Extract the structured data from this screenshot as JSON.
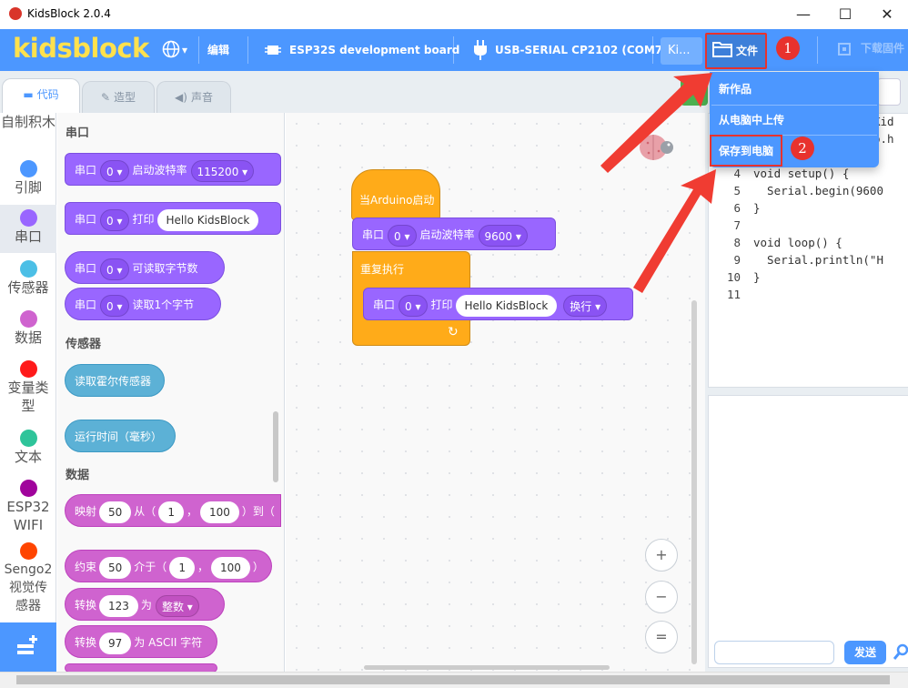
{
  "window": {
    "title": "KidsBlock 2.0.4",
    "minimize": "—",
    "maximize": "☐",
    "close": "✕"
  },
  "menubar": {
    "logo": "kidsblock",
    "language_caret": "▾",
    "edit": "编辑",
    "board": "ESP32S development board",
    "port": "USB-SERIAL CP2102 (COM7)",
    "project_name": "Ki...",
    "file": "文件",
    "download": "下载固件"
  },
  "markers": {
    "one": "1",
    "two": "2"
  },
  "tabs": {
    "code": "代码",
    "costume": "造型",
    "sound": "声音"
  },
  "categories": [
    {
      "label": "自制积木",
      "color": ""
    },
    {
      "label": "引脚",
      "color": "#4c97ff"
    },
    {
      "label": "串口",
      "color": "#9966ff"
    },
    {
      "label": "传感器",
      "color": "#4cbfe6"
    },
    {
      "label": "数据",
      "color": "#cf63cf"
    },
    {
      "label": "变量类型",
      "color": "#ff1a1a"
    },
    {
      "label": "文本",
      "color": "#2ec49a"
    },
    {
      "label": "ESP32 WIFI",
      "color": "#a0049c"
    },
    {
      "label": "Sengo2视觉传感器",
      "color": "#ff4500"
    }
  ],
  "palette": {
    "serial_heading": "串口",
    "b1": {
      "a": "串口",
      "port": "0",
      "b": "启动波特率",
      "baud": "115200"
    },
    "b2": {
      "a": "串口",
      "port": "0",
      "b": "打印",
      "text": "Hello KidsBlock"
    },
    "b3": {
      "a": "串口",
      "port": "0",
      "b": "可读取字节数"
    },
    "b4": {
      "a": "串口",
      "port": "0",
      "b": "读取1个字节"
    },
    "sensor_heading": "传感器",
    "hall": "读取霍尔传感器",
    "runtime": "运行时间（毫秒）",
    "data_heading": "数据",
    "map": {
      "a": "映射",
      "v": "50",
      "b": "从（",
      "lo": "1",
      "comma": "，",
      "hi": "100",
      "c": "）到（"
    },
    "constrain": {
      "a": "约束",
      "v": "50",
      "b": "介于（",
      "lo": "1",
      "comma": "，",
      "hi": "100",
      "c": "）"
    },
    "convert": {
      "a": "转换",
      "v": "123",
      "b": "为",
      "type": "整数"
    },
    "ascii": {
      "a": "转换",
      "v": "97",
      "b": "为 ASCII 字符"
    }
  },
  "workspace": {
    "hat": "当Arduino启动",
    "begin": {
      "a": "串口",
      "port": "0",
      "b": "启动波特率",
      "baud": "9600"
    },
    "forever": "重复执行",
    "print": {
      "a": "串口",
      "port": "0",
      "b": "打印",
      "text": "Hello KidsBlock",
      "mode": "换行"
    },
    "loop_arrow": "↻",
    "zoom_in": "+",
    "zoom_out": "−",
    "zoom_reset": "="
  },
  "file_menu": {
    "new": "新作品",
    "upload": "从电脑中上传",
    "save": "保存到电脑"
  },
  "code": {
    "top1": "Kid",
    "top2": "o.h",
    "lines": [
      {
        "n": "4",
        "t": "void setup() {"
      },
      {
        "n": "5",
        "t": "  Serial.begin(9600"
      },
      {
        "n": "6",
        "t": "}"
      },
      {
        "n": "7",
        "t": ""
      },
      {
        "n": "8",
        "t": "void loop() {"
      },
      {
        "n": "9",
        "t": "  Serial.println(\"H"
      },
      {
        "n": "10",
        "t": "}"
      },
      {
        "n": "11",
        "t": ""
      }
    ]
  },
  "serial": {
    "send": "发送"
  },
  "colors": {
    "menubar": "#4c97ff",
    "serial": "#9966ff",
    "control": "#ffab19",
    "sensor": "#5cb1d6",
    "data": "#cf63cf",
    "highlight": "#e8322d"
  }
}
